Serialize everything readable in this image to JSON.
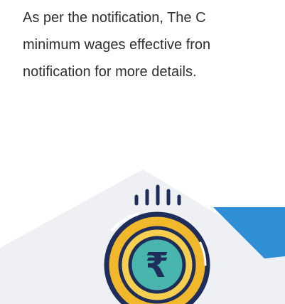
{
  "article": {
    "lines": [
      "As per the notification, The C",
      "minimum wages effective fron",
      "notification for more details."
    ]
  },
  "illustration": {
    "icon": "rupee-coin-icon",
    "symbol": "₹",
    "colors": {
      "house": "#eef0f3",
      "banner": "#2f8fd6",
      "coin_outer": "#f2b82c",
      "coin_inner": "#49b6ad",
      "outline": "#1f2d5a"
    }
  }
}
